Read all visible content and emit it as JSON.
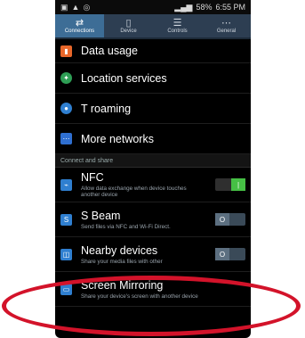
{
  "status_bar": {
    "time": "6:55 PM",
    "battery": "58%"
  },
  "tabs": [
    {
      "label": "Connections",
      "icon": "swap-arrows-icon",
      "active": true
    },
    {
      "label": "Device",
      "icon": "device-icon",
      "active": false
    },
    {
      "label": "Controls",
      "icon": "sliders-icon",
      "active": false
    },
    {
      "label": "General",
      "icon": "more-icon",
      "active": false
    }
  ],
  "items": {
    "data_usage": "Data usage",
    "location": "Location services",
    "roaming": "T roaming",
    "more_networks": "More networks"
  },
  "section_label": "Connect and share",
  "nfc": {
    "title": "NFC",
    "desc": "Allow data exchange when device touches another device",
    "toggle": "on"
  },
  "sbeam": {
    "title": "S Beam",
    "desc": "Send files via NFC and Wi-Fi Direct.",
    "toggle": "off"
  },
  "nearby": {
    "title": "Nearby devices",
    "desc": "Share your media files with other",
    "toggle": "off"
  },
  "mirroring": {
    "title": "Screen Mirroring",
    "desc": "Share your device's screen with another device"
  },
  "colors": {
    "highlight": "#d3132a",
    "tab_active": "#3d6d96",
    "toggle_on": "#46c045"
  }
}
